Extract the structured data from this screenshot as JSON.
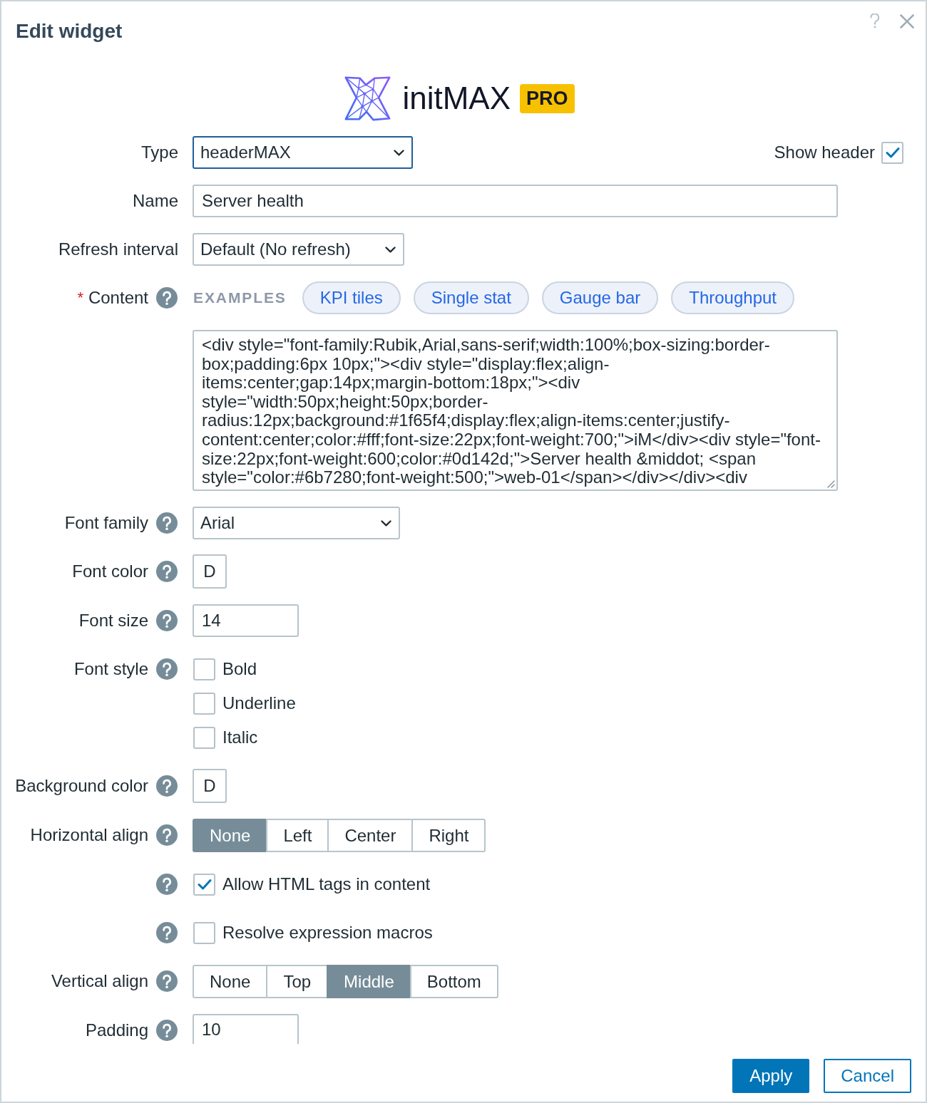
{
  "dialog": {
    "title": "Edit widget"
  },
  "logo": {
    "wordmark": "initMAX",
    "badge": "PRO"
  },
  "type": {
    "label": "Type",
    "value": "headerMAX",
    "focused": true
  },
  "show_header": {
    "label": "Show header",
    "checked": true
  },
  "name": {
    "label": "Name",
    "value": "Server health"
  },
  "refresh_interval": {
    "label": "Refresh interval",
    "value": "Default (No refresh)"
  },
  "content": {
    "required_mark": "*",
    "label": "Content",
    "help": true,
    "examples_label": "EXAMPLES",
    "examples": [
      "KPI tiles",
      "Single stat",
      "Gauge bar",
      "Throughput"
    ],
    "value": "<div style=\"font-family:Rubik,Arial,sans-serif;width:100%;box-sizing:border-box;padding:6px 10px;\"><div style=\"display:flex;align-items:center;gap:14px;margin-bottom:18px;\"><div style=\"width:50px;height:50px;border-radius:12px;background:#1f65f4;display:flex;align-items:center;justify-content:center;color:#fff;font-size:22px;font-weight:700;\">iM</div><div style=\"font-size:22px;font-weight:600;color:#0d142d;\">Server health &middot; <span style=\"color:#6b7280;font-weight:500;\">web-01</span></div></div><div"
  },
  "font_family": {
    "label": "Font family",
    "help": true,
    "value": "Arial"
  },
  "font_color": {
    "label": "Font color",
    "help": true,
    "value": "D"
  },
  "font_size": {
    "label": "Font size",
    "help": true,
    "value": "14"
  },
  "font_style": {
    "label": "Font style",
    "help": true,
    "options": [
      {
        "label": "Bold",
        "checked": false
      },
      {
        "label": "Underline",
        "checked": false
      },
      {
        "label": "Italic",
        "checked": false
      }
    ]
  },
  "background_color": {
    "label": "Background color",
    "help": true,
    "value": "D"
  },
  "horizontal_align": {
    "label": "Horizontal align",
    "help": true,
    "options": [
      {
        "label": "None",
        "selected": true
      },
      {
        "label": "Left",
        "selected": false
      },
      {
        "label": "Center",
        "selected": false
      },
      {
        "label": "Right",
        "selected": false
      }
    ]
  },
  "allow_html": {
    "help": true,
    "label": "Allow HTML tags in content",
    "checked": true
  },
  "resolve_macros": {
    "help": true,
    "label": "Resolve expression macros",
    "checked": false
  },
  "vertical_align": {
    "label": "Vertical align",
    "help": true,
    "options": [
      {
        "label": "None",
        "selected": false
      },
      {
        "label": "Top",
        "selected": false
      },
      {
        "label": "Middle",
        "selected": true
      },
      {
        "label": "Bottom",
        "selected": false
      }
    ]
  },
  "padding": {
    "label": "Padding",
    "help": true,
    "value": "10"
  },
  "buttons": [
    {
      "label": "Apply",
      "kind": "primary"
    },
    {
      "label": "Cancel",
      "kind": "secondary"
    }
  ]
}
